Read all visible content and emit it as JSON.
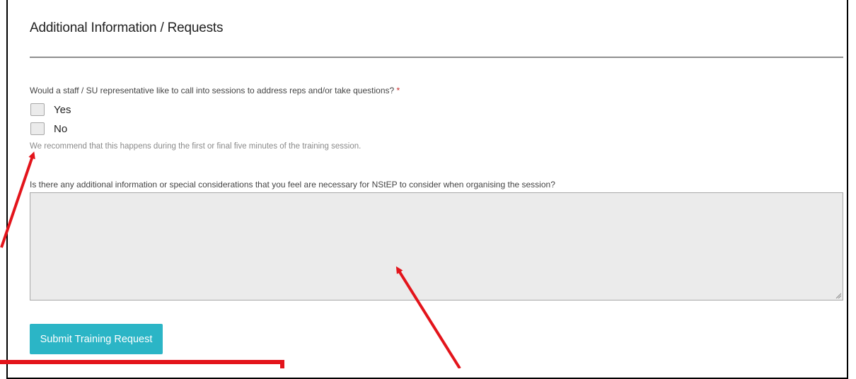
{
  "section": {
    "title": "Additional Information / Requests"
  },
  "question1": {
    "label": "Would a staff / SU representative like to call into sessions to address reps and/or take questions?",
    "required_mark": "*",
    "options": [
      {
        "label": "Yes",
        "checked": false
      },
      {
        "label": "No",
        "checked": false
      }
    ],
    "help_text": "We recommend that this happens during the first or final five minutes of the training session."
  },
  "question2": {
    "label": "Is there any additional information or special considerations that you feel are necessary for NStEP to consider when organising the session?",
    "value": ""
  },
  "submit": {
    "label": "Submit Training Request"
  },
  "annotation_color": "#e3141b",
  "accent_color": "#2bb5c6"
}
